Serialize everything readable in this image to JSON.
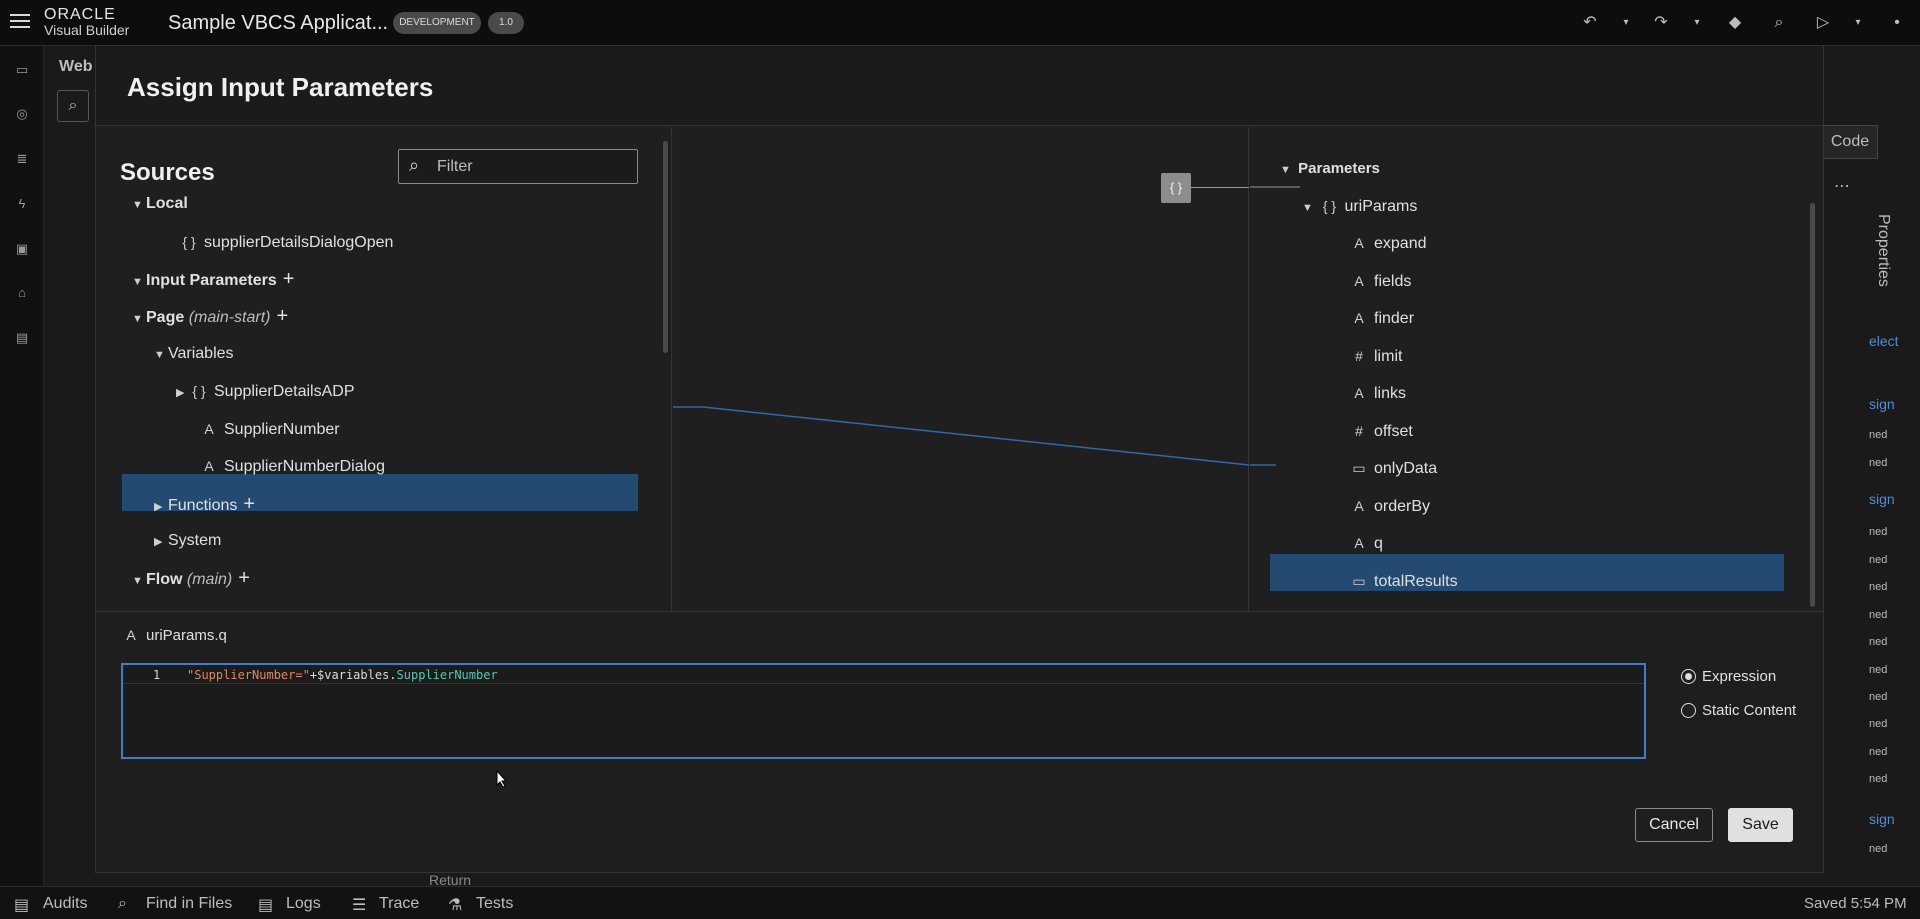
{
  "header": {
    "logo_top": "ORACLE",
    "logo_bottom": "Visual Builder",
    "app_title": "Sample VBCS Applicat...",
    "badge_env": "DEVELOPMENT",
    "badge_version": "1.0"
  },
  "behind": {
    "crumb": "Web",
    "code_tab": "Code",
    "properties_tab": "Properties",
    "edge_texts": [
      "elect",
      "sign",
      "ned",
      "ned",
      "sign",
      "ned",
      "ned",
      "ned",
      "ned",
      "ned",
      "ned",
      "ned",
      "ned",
      "ned",
      "ned",
      "sign",
      "ned"
    ],
    "return_text": "Return"
  },
  "status": {
    "audits": "Audits",
    "find_in_files": "Find in Files",
    "logs": "Logs",
    "trace": "Trace",
    "tests": "Tests",
    "saved": "Saved 5:54 PM"
  },
  "modal": {
    "title": "Assign Input Parameters",
    "sources_title": "Sources",
    "filter_placeholder": "Filter",
    "sources": {
      "local": "Local",
      "supplier_dialog_open": "supplierDetailsDialogOpen",
      "input_parameters": "Input Parameters",
      "page": "Page",
      "page_id": "(main-start)",
      "variables": "Variables",
      "supplier_details_adp": "SupplierDetailsADP",
      "supplier_number": "SupplierNumber",
      "supplier_number_dialog": "SupplierNumberDialog",
      "functions": "Functions",
      "system": "System",
      "flow": "Flow",
      "flow_id": "(main)"
    },
    "targets": {
      "parameters": "Parameters",
      "uri_params": "uriParams",
      "items": [
        "expand",
        "fields",
        "finder",
        "limit",
        "links",
        "offset",
        "onlyData",
        "orderBy",
        "q",
        "totalResults"
      ]
    },
    "expression": {
      "target_label": "uriParams.q",
      "line_number": "1",
      "code_string": "\"SupplierNumber=\"",
      "code_plus": "+$variables.",
      "code_var": "SupplierNumber",
      "mode_expression": "Expression",
      "mode_static": "Static Content"
    },
    "cancel_label": "Cancel",
    "save_label": "Save"
  }
}
